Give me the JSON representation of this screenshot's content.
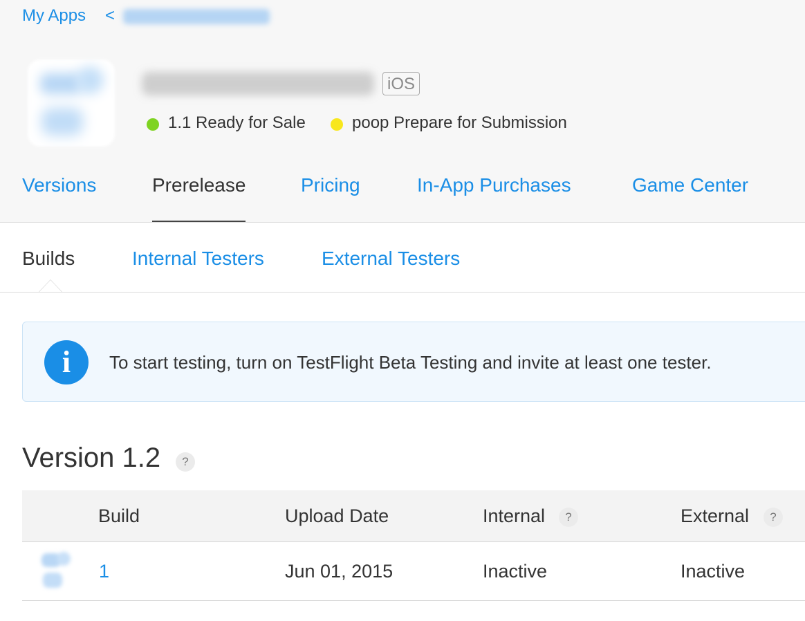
{
  "breadcrumb": {
    "root": "My Apps",
    "separator": "<"
  },
  "app": {
    "platform": "iOS",
    "statuses": [
      {
        "label": "1.1 Ready for Sale",
        "color": "#7ed321"
      },
      {
        "label": "poop Prepare for Submission",
        "color": "#f8e71c"
      }
    ]
  },
  "main_tabs": [
    "Versions",
    "Prerelease",
    "Pricing",
    "In-App Purchases",
    "Game Center"
  ],
  "main_tab_active": "Prerelease",
  "sub_tabs": [
    "Builds",
    "Internal Testers",
    "External Testers"
  ],
  "sub_tab_active": "Builds",
  "info_banner": {
    "icon": "info-icon",
    "text": "To start testing, turn on TestFlight Beta Testing and invite at least one tester."
  },
  "version_section": {
    "title": "Version 1.2",
    "help": "?",
    "columns": [
      "Build",
      "Upload Date",
      "Internal",
      "External"
    ],
    "column_help": "?",
    "rows": [
      {
        "build": "1",
        "upload_date": "Jun 01, 2015",
        "internal": "Inactive",
        "external": "Inactive"
      }
    ]
  },
  "colors": {
    "accent": "#1a8ee6",
    "header_bg": "#f7f7f7",
    "banner_bg": "#f1f8fe"
  }
}
